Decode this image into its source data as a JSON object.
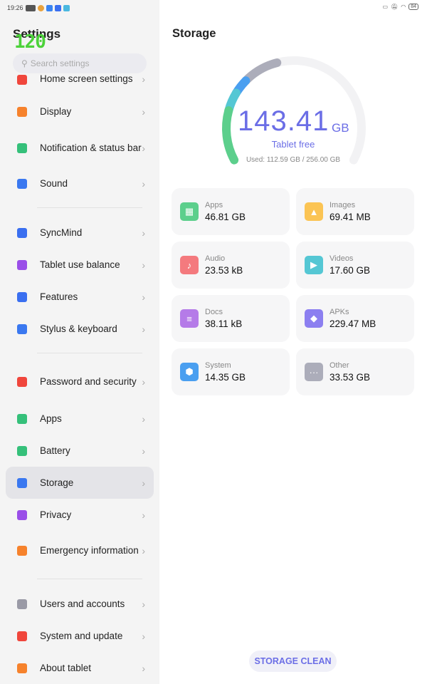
{
  "status_bar": {
    "time": "19:26",
    "battery": "84",
    "left_icons": [
      "speed-badge-icon",
      "chrome-icon",
      "google-icon",
      "docs-icon",
      "app-icon"
    ],
    "right_icons": [
      "cast-icon",
      "mute-icon",
      "wifi-icon",
      "battery-icon"
    ]
  },
  "fps_overlay": "120",
  "sidebar": {
    "title": "Settings",
    "search_placeholder": "Search settings",
    "items": [
      {
        "label": "Home screen settings",
        "icon": "home-icon",
        "color": "#f0463c"
      },
      {
        "label": "Display",
        "icon": "sun-icon",
        "color": "#f6822c"
      },
      {
        "label": "Notification & status bar",
        "icon": "notification-icon",
        "color": "#35c07a"
      },
      {
        "label": "Sound",
        "icon": "speaker-icon",
        "color": "#3a78f0"
      },
      {
        "label": "SyncMind",
        "icon": "ai-icon",
        "color": "#3a6ff0"
      },
      {
        "label": "Tablet use balance",
        "icon": "hourglass-icon",
        "color": "#9a4ee8"
      },
      {
        "label": "Features",
        "icon": "hand-icon",
        "color": "#3a6ff0"
      },
      {
        "label": "Stylus & keyboard",
        "icon": "keyboard-icon",
        "color": "#3a78f0"
      },
      {
        "label": "Password and security",
        "icon": "lock-icon",
        "color": "#f0463c"
      },
      {
        "label": "Apps",
        "icon": "apps-icon",
        "color": "#35c07a"
      },
      {
        "label": "Battery",
        "icon": "battery-icon",
        "color": "#35c07a"
      },
      {
        "label": "Storage",
        "icon": "storage-icon",
        "color": "#3a78f0",
        "selected": true
      },
      {
        "label": "Privacy",
        "icon": "eye-icon",
        "color": "#9a4ee8"
      },
      {
        "label": "Emergency information",
        "icon": "sos-icon",
        "color": "#f6822c"
      },
      {
        "label": "Users and accounts",
        "icon": "user-icon",
        "color": "#9a9aa6"
      },
      {
        "label": "System and update",
        "icon": "update-icon",
        "color": "#f0463c"
      },
      {
        "label": "About tablet",
        "icon": "info-icon",
        "color": "#f6822c"
      }
    ]
  },
  "storage": {
    "title": "Storage",
    "free_value": "143.41",
    "free_unit": "GB",
    "free_label": "Tablet free",
    "used_text": "Used: 112.59 GB / 256.00 GB",
    "total_gb": 256,
    "gauge_segments": [
      {
        "category": "Apps",
        "gb": 46.81,
        "color": "#5ccf8c"
      },
      {
        "category": "Videos",
        "gb": 17.6,
        "color": "#55c7d4"
      },
      {
        "category": "System",
        "gb": 14.35,
        "color": "#4a9ff0"
      },
      {
        "category": "Other",
        "gb": 33.53,
        "color": "#acadba"
      }
    ],
    "track_color": "#f2f2f4",
    "categories": [
      {
        "label": "Apps",
        "value": "46.81 GB",
        "icon": "apps-grid-icon",
        "color": "#5ccf8c",
        "glyph": "▦"
      },
      {
        "label": "Images",
        "value": "69.41 MB",
        "icon": "image-icon",
        "color": "#fbc454",
        "glyph": "▲"
      },
      {
        "label": "Audio",
        "value": "23.53 kB",
        "icon": "music-note-icon",
        "color": "#f47a7e",
        "glyph": "♪"
      },
      {
        "label": "Videos",
        "value": "17.60 GB",
        "icon": "play-icon",
        "color": "#55c7d4",
        "glyph": "▶"
      },
      {
        "label": "Docs",
        "value": "38.11 kB",
        "icon": "document-icon",
        "color": "#b57be8",
        "glyph": "≡"
      },
      {
        "label": "APKs",
        "value": "229.47 MB",
        "icon": "package-icon",
        "color": "#8c7ff0",
        "glyph": "◆"
      },
      {
        "label": "System",
        "value": "14.35 GB",
        "icon": "android-icon",
        "color": "#4a9ff0",
        "glyph": "⬢"
      },
      {
        "label": "Other",
        "value": "33.53 GB",
        "icon": "more-icon",
        "color": "#acadba",
        "glyph": "···"
      }
    ],
    "clean_button": "STORAGE CLEAN",
    "accent": "#6b6ee6"
  }
}
